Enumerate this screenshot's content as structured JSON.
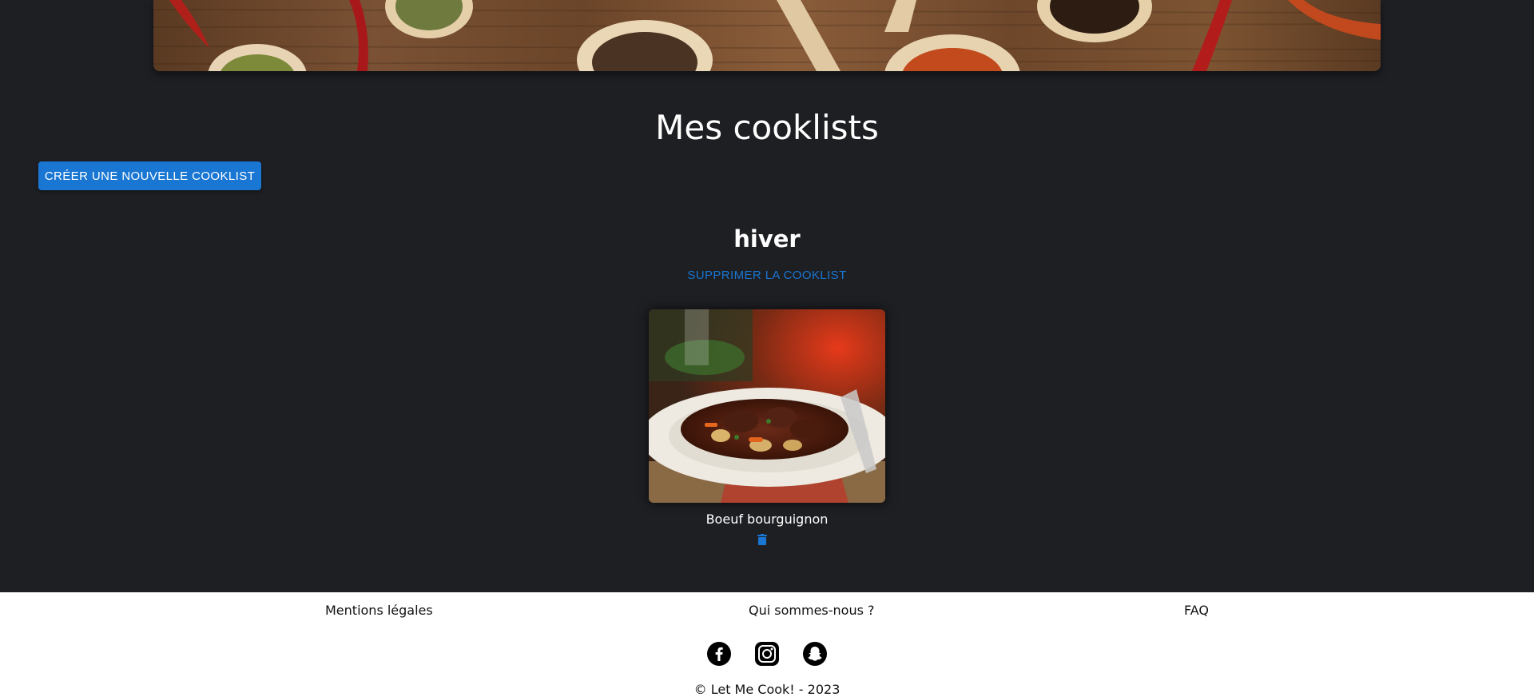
{
  "page": {
    "title": "Mes cooklists",
    "create_button_label": "Créer une nouvelle cooklist"
  },
  "cooklist": {
    "name": "hiver",
    "delete_label": "Supprimer la cooklist",
    "recipes": [
      {
        "name": "Boeuf bourguignon",
        "image": "beef-stew-photo",
        "delete_icon": "trash-icon"
      }
    ]
  },
  "footer": {
    "links": [
      "Mentions légales",
      "Qui sommes-nous ?",
      "FAQ"
    ],
    "social_icons": [
      "facebook-icon",
      "instagram-icon",
      "snapchat-icon"
    ],
    "copyright": "© Let Me Cook! - 2023"
  },
  "colors": {
    "background": "#1e1f23",
    "accent": "#1976d2",
    "footer_background": "#ffffff"
  }
}
